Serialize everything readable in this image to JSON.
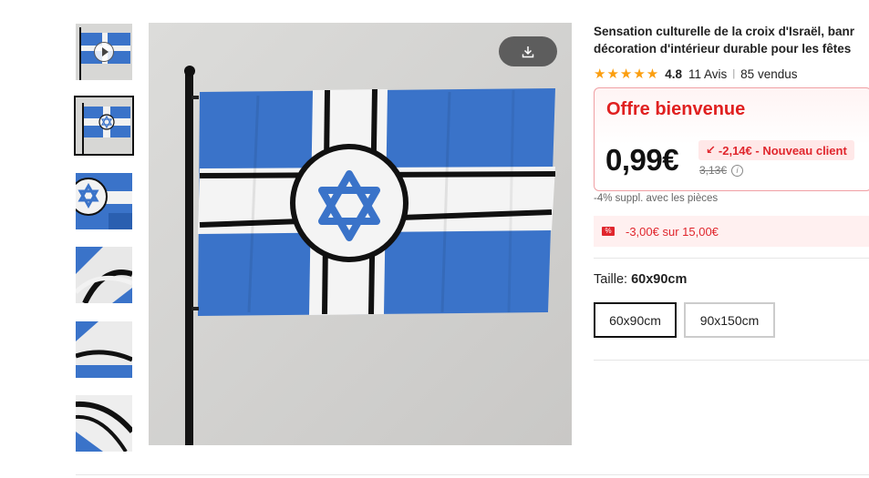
{
  "product": {
    "title_line1": "Sensation culturelle de la croix d'Israël, banr",
    "title_line2": "décoration d'intérieur durable pour les fêtes",
    "stars": "★★★★★",
    "rating": "4.8",
    "reviews": "11 Avis",
    "separator": "|",
    "sold": "85 vendus"
  },
  "offer": {
    "title": "Offre bienvenue",
    "price": "0,99€",
    "discount_icon": "↙",
    "discount": "-2,14€ - Nouveau client",
    "old_price": "3,13€",
    "info_glyph": "i"
  },
  "coins_note": "-4% suppl. avec les pièces",
  "coupon": {
    "icon_glyph": "%",
    "text": "-3,00€ sur 15,00€"
  },
  "size": {
    "label": "Taille: ",
    "selected": "60x90cm",
    "options": [
      "60x90cm",
      "90x150cm"
    ]
  },
  "colors": {
    "accent_red": "#e0262d",
    "star": "#fb9e0f",
    "flag_blue": "#3a73c9"
  },
  "icons": {
    "download": "download-icon",
    "play": "play-icon",
    "coupon": "coupon-icon",
    "info": "info-icon"
  }
}
